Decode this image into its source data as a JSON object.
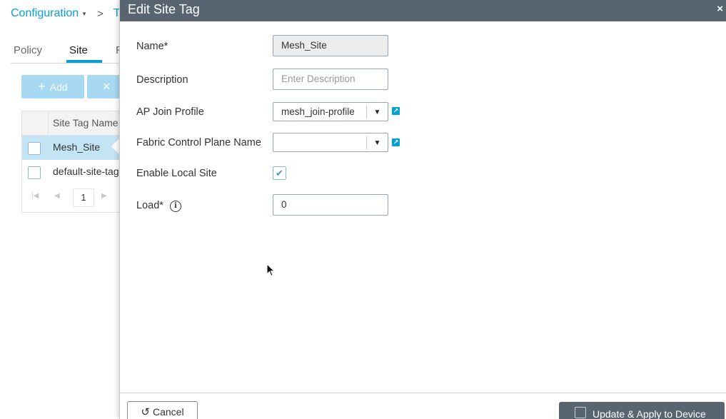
{
  "breadcrumb": {
    "root": "Configuration",
    "current": "Ta",
    "separator": ">"
  },
  "tabs": [
    {
      "label": "Policy"
    },
    {
      "label": "Site"
    },
    {
      "label": "R"
    }
  ],
  "toolbar": {
    "add_label": "Add",
    "delete_glyph": "×"
  },
  "grid": {
    "column_header": "Site Tag Name",
    "rows": [
      {
        "name": "Mesh_Site",
        "selected": true
      },
      {
        "name": "default-site-tag",
        "selected": false
      }
    ],
    "pager": {
      "page": "1"
    }
  },
  "modal": {
    "title": "Edit Site Tag",
    "close_glyph": "×",
    "fields": {
      "name": {
        "label": "Name*",
        "value": "Mesh_Site"
      },
      "description": {
        "label": "Description",
        "placeholder": "Enter Description"
      },
      "ap_join_profile": {
        "label": "AP Join Profile",
        "value": "mesh_join-profile"
      },
      "fabric_control_plane": {
        "label": "Fabric Control Plane Name",
        "value": ""
      },
      "enable_local_site": {
        "label": "Enable Local Site",
        "checked": true,
        "check_glyph": "✔"
      },
      "load": {
        "label": "Load*",
        "value": "0",
        "info_glyph": "i"
      }
    },
    "footer": {
      "cancel_label": "Cancel",
      "update_label": "Update & Apply to Device"
    }
  },
  "colors": {
    "accent": "#049fd9",
    "header": "#58646f",
    "selected_row": "#c3e4f5"
  },
  "icons": {
    "dropdown": "chevron-down-icon",
    "external": "external-link-icon",
    "info": "info-icon",
    "undo": "undo-icon",
    "save": "save-icon",
    "cursor": "mouse-cursor-icon"
  }
}
